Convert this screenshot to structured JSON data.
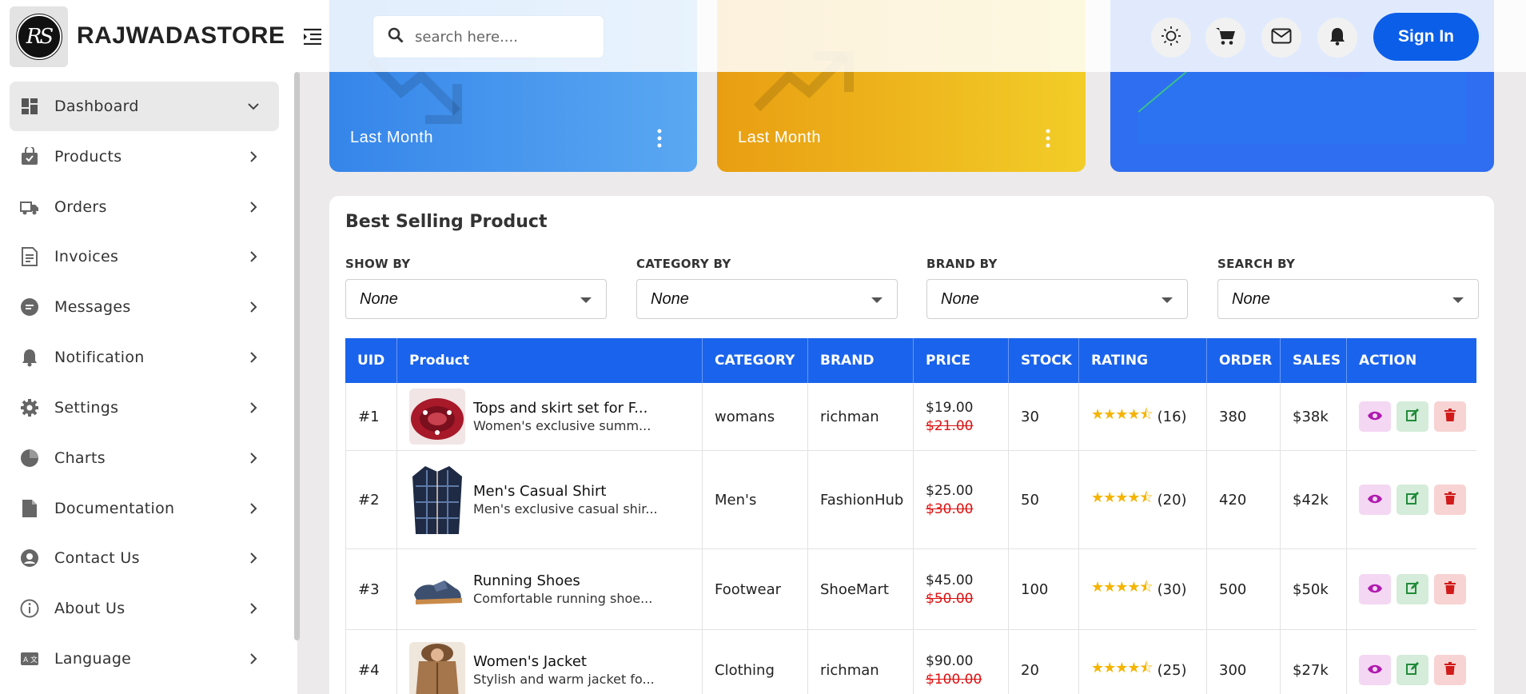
{
  "header": {
    "brand": "RAJWADASTORE",
    "logo_text": "RS",
    "search_placeholder": "search here....",
    "signin_label": "Sign In",
    "icons": [
      "sun-icon",
      "cart-icon",
      "mail-icon",
      "bell-icon"
    ]
  },
  "sidebar": {
    "items": [
      {
        "label": "Dashboard",
        "icon": "dashboard-icon",
        "active": true
      },
      {
        "label": "Products",
        "icon": "products-icon"
      },
      {
        "label": "Orders",
        "icon": "truck-icon"
      },
      {
        "label": "Invoices",
        "icon": "invoice-icon"
      },
      {
        "label": "Messages",
        "icon": "message-icon"
      },
      {
        "label": "Notification",
        "icon": "bell-icon"
      },
      {
        "label": "Settings",
        "icon": "gear-icon"
      },
      {
        "label": "Charts",
        "icon": "pie-chart-icon"
      },
      {
        "label": "Documentation",
        "icon": "document-icon"
      },
      {
        "label": "Contact Us",
        "icon": "contact-icon"
      },
      {
        "label": "About Us",
        "icon": "info-icon"
      },
      {
        "label": "Language",
        "icon": "language-icon"
      }
    ]
  },
  "cards": [
    {
      "label": "Last Month",
      "color_from": "#3585ea",
      "color_to": "#5aa8f2"
    },
    {
      "label": "Last Month",
      "color_from": "#e99e12",
      "color_to": "#f2cd28"
    },
    {
      "color_from": "#2f6ef1",
      "color_to": "#2f6ef1"
    }
  ],
  "panel": {
    "title": "Best Selling Product",
    "filters": [
      {
        "label": "SHOW BY",
        "value": "None"
      },
      {
        "label": "CATEGORY BY",
        "value": "None"
      },
      {
        "label": "BRAND BY",
        "value": "None"
      },
      {
        "label": "SEARCH BY",
        "value": "None"
      }
    ],
    "columns": [
      "UID",
      "Product",
      "CATEGORY",
      "BRAND",
      "PRICE",
      "STOCK",
      "RATING",
      "ORDER",
      "SALES",
      "ACTION"
    ],
    "rows": [
      {
        "uid": "#1",
        "name": "Tops and skirt set for F...",
        "desc": "Women's exclusive summ...",
        "category": "womans",
        "brand": "richman",
        "price": "$19.00",
        "old_price": "$21.00",
        "stock": "30",
        "rating": 4.5,
        "reviews": "(16)",
        "order": "380",
        "sales": "$38k"
      },
      {
        "uid": "#2",
        "name": "Men's Casual Shirt",
        "desc": "Men's exclusive casual shir...",
        "category": "Men's",
        "brand": "FashionHub",
        "price": "$25.00",
        "old_price": "$30.00",
        "stock": "50",
        "rating": 4.5,
        "reviews": "(20)",
        "order": "420",
        "sales": "$42k"
      },
      {
        "uid": "#3",
        "name": "Running Shoes",
        "desc": "Comfortable running shoe...",
        "category": "Footwear",
        "brand": "ShoeMart",
        "price": "$45.00",
        "old_price": "$50.00",
        "stock": "100",
        "rating": 4.5,
        "reviews": "(30)",
        "order": "500",
        "sales": "$50k"
      },
      {
        "uid": "#4",
        "name": "Women's Jacket",
        "desc": "Stylish and warm jacket fo...",
        "category": "Clothing",
        "brand": "richman",
        "price": "$90.00",
        "old_price": "$100.00",
        "stock": "20",
        "rating": 4.5,
        "reviews": "(25)",
        "order": "300",
        "sales": "$27k"
      }
    ]
  },
  "colors": {
    "accent": "#1a63ec",
    "signin": "#0b5ee8",
    "star": "#f5b400",
    "old_price": "#dd1111"
  }
}
